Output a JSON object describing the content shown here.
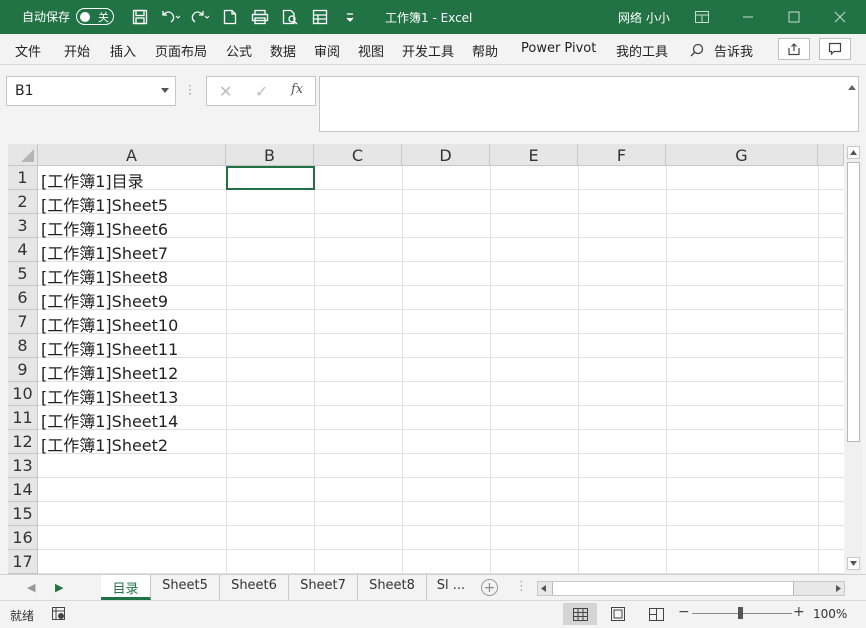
{
  "titlebar": {
    "autosave_label": "自动保存",
    "autosave_state": "关",
    "title": "工作簿1  -  Excel",
    "user": "网络 小小",
    "bg_color": "#217346"
  },
  "ribbon": {
    "tabs": [
      "文件",
      "开始",
      "插入",
      "页面布局",
      "公式",
      "数据",
      "审阅",
      "视图",
      "开发工具",
      "帮助",
      "Power Pivot",
      "我的工具",
      "告诉我"
    ]
  },
  "formula_bar": {
    "name_box": "B1",
    "fx_label": "fx",
    "value": ""
  },
  "grid": {
    "columns": [
      "A",
      "B",
      "C",
      "D",
      "E",
      "F",
      "G"
    ],
    "rows": [
      "1",
      "2",
      "3",
      "4",
      "5",
      "6",
      "7",
      "8",
      "9",
      "10",
      "11",
      "12",
      "13",
      "14",
      "15",
      "16",
      "17"
    ],
    "cells_a": [
      "[工作簿1]目录",
      "[工作簿1]Sheet5",
      "[工作簿1]Sheet6",
      "[工作簿1]Sheet7",
      "[工作簿1]Sheet8",
      "[工作簿1]Sheet9",
      "[工作簿1]Sheet10",
      "[工作簿1]Sheet11",
      "[工作簿1]Sheet12",
      "[工作簿1]Sheet13",
      "[工作簿1]Sheet14",
      "[工作簿1]Sheet2"
    ],
    "selected_cell": "B1"
  },
  "sheets": {
    "tabs": [
      "目录",
      "Sheet5",
      "Sheet6",
      "Sheet7",
      "Sheet8",
      "Sl ..."
    ],
    "active": "目录",
    "accent": "#217346"
  },
  "status": {
    "ready": "就绪",
    "zoom": "100%"
  }
}
